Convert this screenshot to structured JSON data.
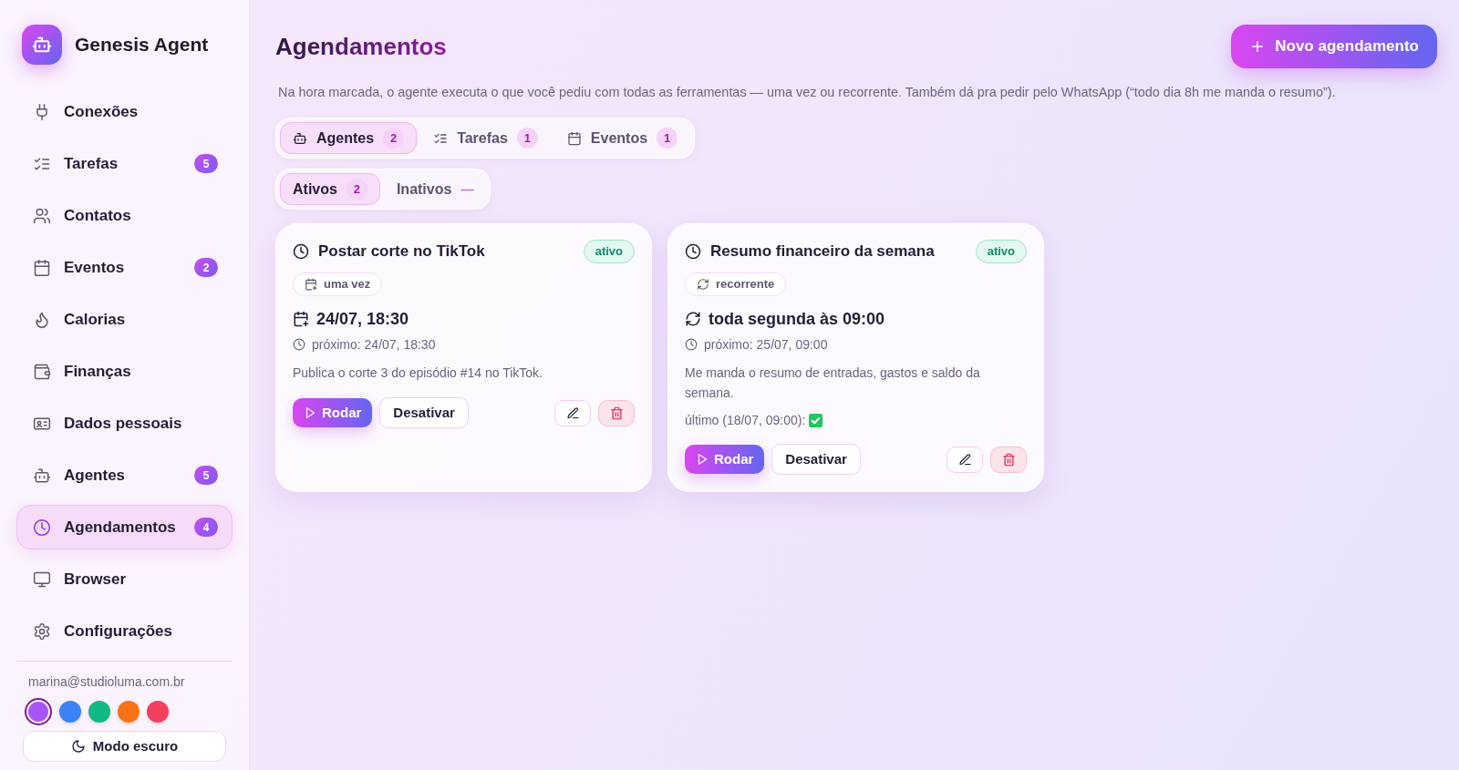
{
  "sidebar": {
    "brand": "Genesis Agent",
    "items": [
      {
        "label": "Conexões",
        "selected": false
      },
      {
        "label": "Tarefas",
        "badge": "5",
        "selected": false
      },
      {
        "label": "Contatos",
        "selected": false
      },
      {
        "label": "Eventos",
        "badge": "2",
        "selected": false
      },
      {
        "label": "Calorias",
        "selected": false
      },
      {
        "label": "Finanças",
        "selected": false
      },
      {
        "label": "Dados pessoais",
        "selected": false
      },
      {
        "label": "Agentes",
        "badge": "5",
        "selected": false
      },
      {
        "label": "Agendamentos",
        "badge": "4",
        "selected": true
      },
      {
        "label": "Browser",
        "selected": false
      },
      {
        "label": "Configurações",
        "selected": false
      }
    ],
    "user_email": "marina@studioluma.com.br",
    "theme_swatches": [
      {
        "color": "#a855f7",
        "selected": true
      },
      {
        "color": "#3b82f6",
        "selected": false
      },
      {
        "color": "#10b981",
        "selected": false
      },
      {
        "color": "#f97316",
        "selected": false
      },
      {
        "color": "#f43f5e",
        "selected": false
      }
    ],
    "dark_mode_button": "Modo escuro"
  },
  "header": {
    "title": "Agendamentos",
    "new_button": "Novo agendamento",
    "description": "Na hora marcada, o agente executa o que você pediu com todas as ferramentas — uma vez ou recorrente. Também dá pra pedir pelo WhatsApp (“todo dia 8h me manda o resumo”)."
  },
  "source_tabs": [
    {
      "label": "Agentes",
      "count": "2",
      "selected": true
    },
    {
      "label": "Tarefas",
      "count": "1",
      "selected": false
    },
    {
      "label": "Eventos",
      "count": "1",
      "selected": false
    }
  ],
  "status_tabs": [
    {
      "label": "Ativos",
      "count": "2",
      "count_muted": false,
      "selected": true
    },
    {
      "label": "Inativos",
      "count": "—",
      "count_muted": true,
      "selected": false
    }
  ],
  "cards": [
    {
      "title": "Postar corte no TikTok",
      "status": {
        "label": "ativo",
        "active": true
      },
      "type": {
        "kind": "once",
        "label": "uma vez"
      },
      "schedule": "24/07, 18:30",
      "next_run": "próximo: 24/07, 18:30",
      "description": "Publica o corte 3 do episódio #14 no TikTok.",
      "run_button": "Rodar",
      "toggle_button": "Desativar"
    },
    {
      "title": "Resumo financeiro da semana",
      "status": {
        "label": "ativo",
        "active": true
      },
      "type": {
        "kind": "recurring",
        "label": "recorrente"
      },
      "schedule": "toda segunda às 09:00",
      "next_run": "próximo: 25/07, 09:00",
      "description": "Me manda o resumo de entradas, gastos e saldo da semana.",
      "last_run": {
        "label": "último (18/07, 09:00):",
        "ok": true
      },
      "run_button": "Rodar",
      "toggle_button": "Desativar"
    }
  ]
}
